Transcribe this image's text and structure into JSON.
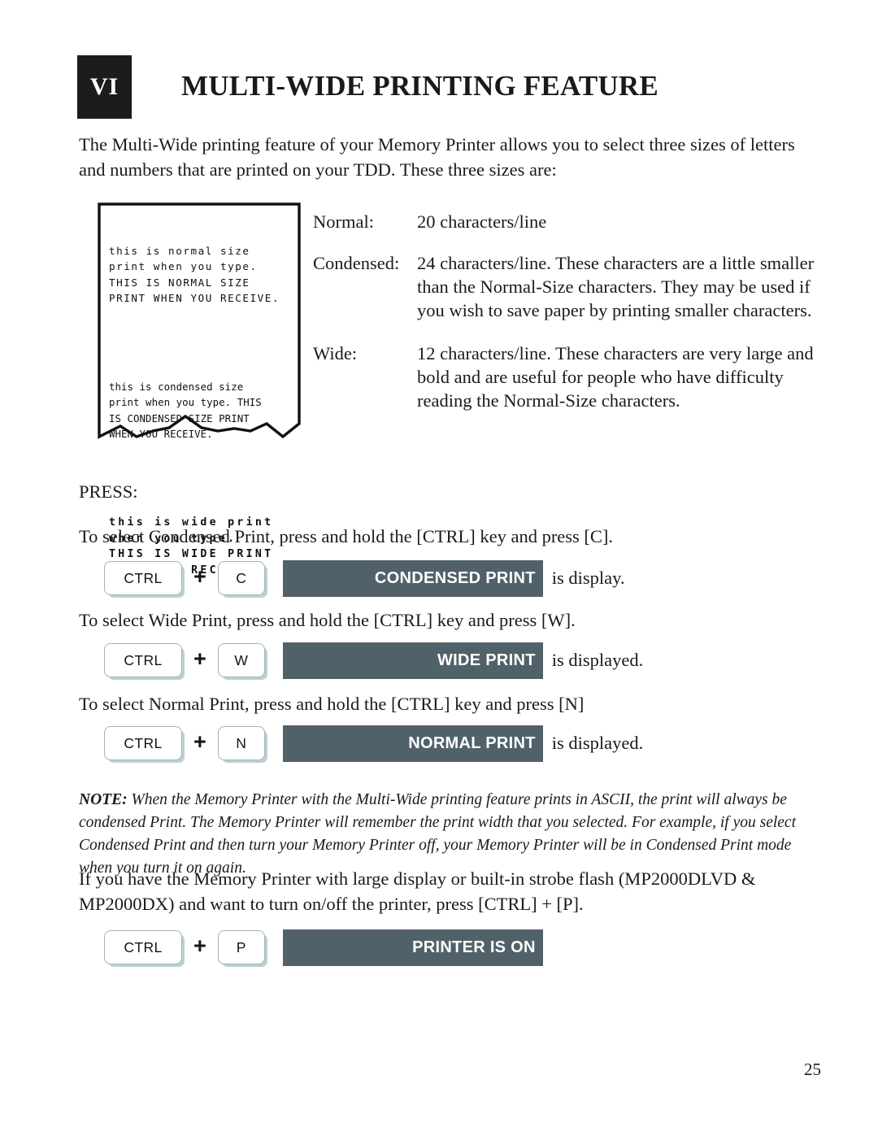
{
  "header": {
    "chapter_number": "VI",
    "title": "MULTI-WIDE PRINTING FEATURE"
  },
  "intro": "The Multi-Wide printing feature of your Memory Printer allows you to select three sizes of letters and numbers that are printed on your TDD. These three sizes are:",
  "printout_sample": {
    "normal_block": "this is normal size\nprint when you type.\nTHIS IS NORMAL SIZE\nPRINT WHEN YOU RECEIVE.",
    "condensed_block": "this is condensed size\nprint when you type. THIS\nIS CONDENSED SIZE PRINT\nWHEN YOU RECEIVE.",
    "wide_block": "this is wide print\nwhen you type.\nTHIS IS WIDE PRINT\nWHEN YOU RECEIVE."
  },
  "sizes": [
    {
      "label": "Normal:",
      "description": "20 characters/line"
    },
    {
      "label": "Condensed:",
      "description": "24 characters/line. These characters are a little smaller than the Normal-Size characters. They may be used if you wish to save paper by printing smaller characters."
    },
    {
      "label": "Wide:",
      "description": "12 characters/line. These characters are very large and bold and are useful for people who have difficulty reading the Normal-Size characters."
    }
  ],
  "press_label": "PRESS:",
  "shortcuts": [
    {
      "instruction": "To select Condensed Print, press and hold the [CTRL] key and press [C].",
      "modifier_key": "CTRL",
      "plus": "+",
      "letter_key": "C",
      "display_text": "CONDENSED PRINT",
      "after_text": "is display."
    },
    {
      "instruction": "To select Wide Print, press and hold the [CTRL] key and press [W].",
      "modifier_key": "CTRL",
      "plus": "+",
      "letter_key": "W",
      "display_text": "WIDE PRINT",
      "after_text": "is displayed."
    },
    {
      "instruction": "To select Normal Print, press and hold the [CTRL] key and press [N]",
      "modifier_key": "CTRL",
      "plus": "+",
      "letter_key": "N",
      "display_text": "NORMAL PRINT",
      "after_text": "is displayed."
    }
  ],
  "note": {
    "label": "NOTE:",
    "text": " When the Memory Printer with the Multi-Wide printing feature prints in ASCII, the print will always be condensed Print. The Memory Printer will remember the print width that you selected. For example, if you select Condensed Print and then turn your Memory Printer off, your Memory Printer will be in Condensed Print mode when you turn it on again."
  },
  "closing": "If you have the Memory Printer with large display or built-in strobe flash (MP2000DLVD & MP2000DX) and want to turn on/off the printer, press [CTRL] + [P].",
  "printer_shortcut": {
    "modifier_key": "CTRL",
    "plus": "+",
    "letter_key": "P",
    "display_text": "PRINTER IS ON",
    "after_text": ""
  },
  "page_number": "25",
  "colors": {
    "badge_background": "#1c1c1c",
    "display_bar": "#51616a",
    "display_text": "#ffffff",
    "key_border": "#9fb4b8",
    "key_shadow": "#bcd0d4",
    "body_text": "#1a1a1a"
  }
}
